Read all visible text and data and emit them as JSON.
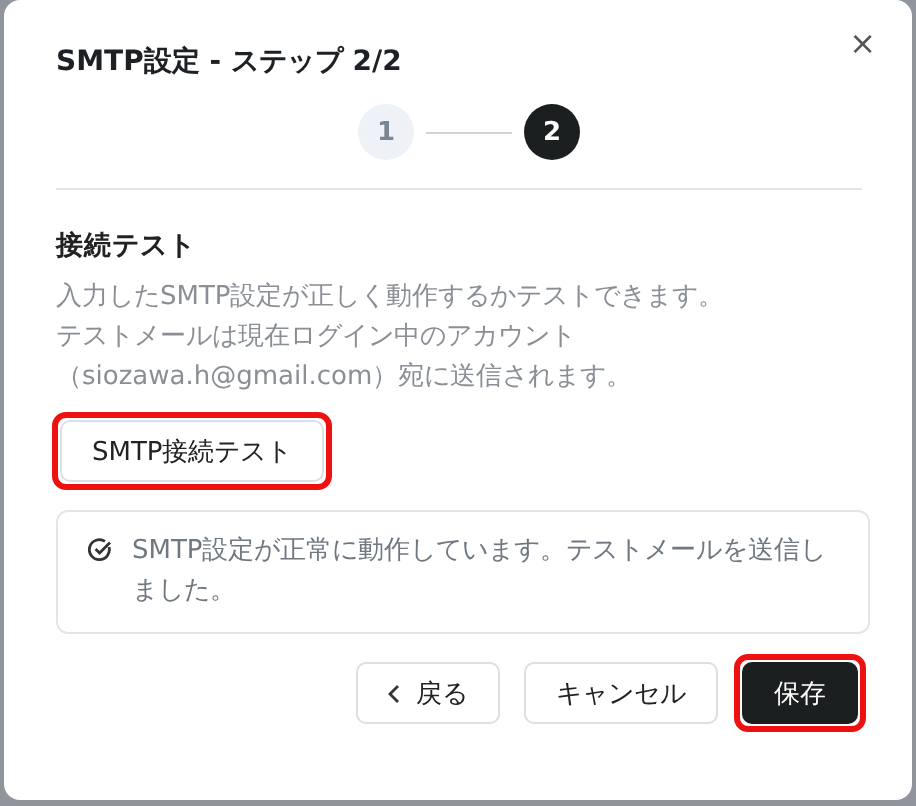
{
  "dialog": {
    "title": "SMTP設定 - ステップ 2/2",
    "close": "×"
  },
  "steps": [
    {
      "label": "1",
      "selected": false
    },
    {
      "label": "2",
      "selected": true
    }
  ],
  "section": {
    "heading": "接続テスト",
    "description": [
      "入力したSMTP設定が正しく動作するかテストできます。",
      "テストメールは現在ログイン中のアカウント",
      "（siozawa.h@gmail.com）宛に送信されます。"
    ]
  },
  "test_button": {
    "label": "SMTP接続テスト",
    "highlighted": true
  },
  "alert": {
    "kind": "success",
    "text": "SMTP設定が正常に動作しています。テストメールを送信しました。"
  },
  "footer": [
    {
      "kind": "back",
      "label": "戻る",
      "highlighted": false
    },
    {
      "kind": "secondary",
      "label": "キャンセル",
      "highlighted": false
    },
    {
      "kind": "primary",
      "label": "保存",
      "highlighted": true
    }
  ]
}
